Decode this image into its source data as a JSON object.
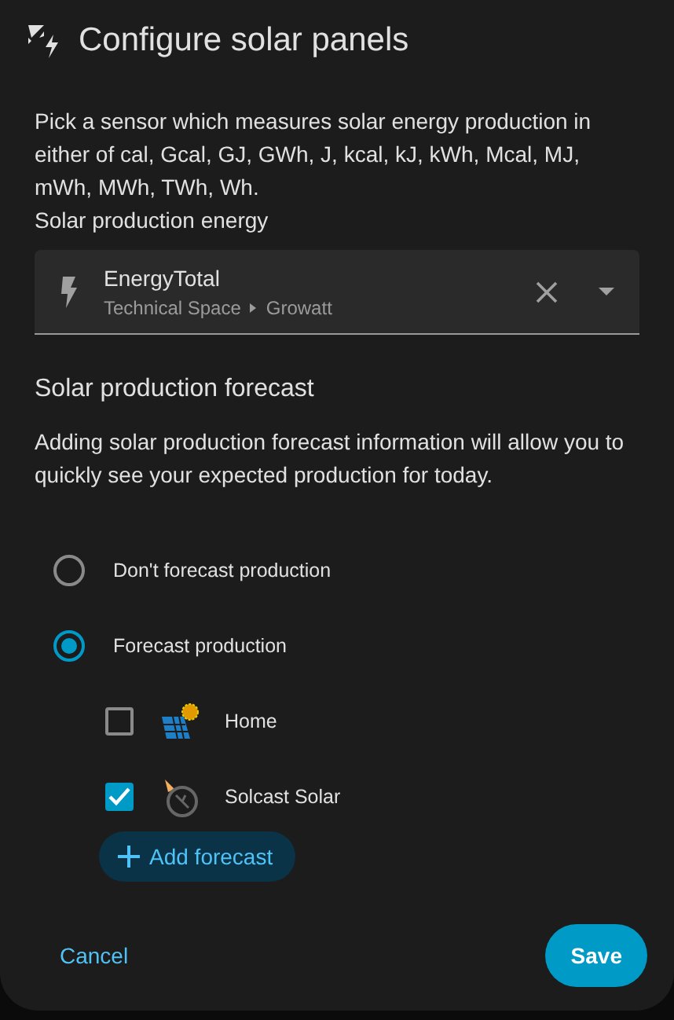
{
  "dialog": {
    "title": "Configure solar panels"
  },
  "description": "Pick a sensor which measures solar energy production in either of cal, Gcal, GJ, GWh, J, kcal, kJ, kWh, Mcal, MJ, mWh, MWh, TWh, Wh.",
  "sensor_field": {
    "label": "Solar production energy",
    "value": "EnergyTotal",
    "area": "Technical Space",
    "device": "Growatt"
  },
  "forecast_section": {
    "heading": "Solar production forecast",
    "description": "Adding solar production forecast information will allow you to quickly see your expected production for today.",
    "options": [
      {
        "label": "Don't forecast production",
        "selected": false
      },
      {
        "label": "Forecast production",
        "selected": true
      }
    ],
    "forecasts": [
      {
        "label": "Home",
        "checked": false,
        "kind": "panel"
      },
      {
        "label": "Solcast Solar",
        "checked": true,
        "kind": "dish"
      }
    ],
    "add_button": "Add forecast"
  },
  "buttons": {
    "cancel": "Cancel",
    "save": "Save"
  }
}
